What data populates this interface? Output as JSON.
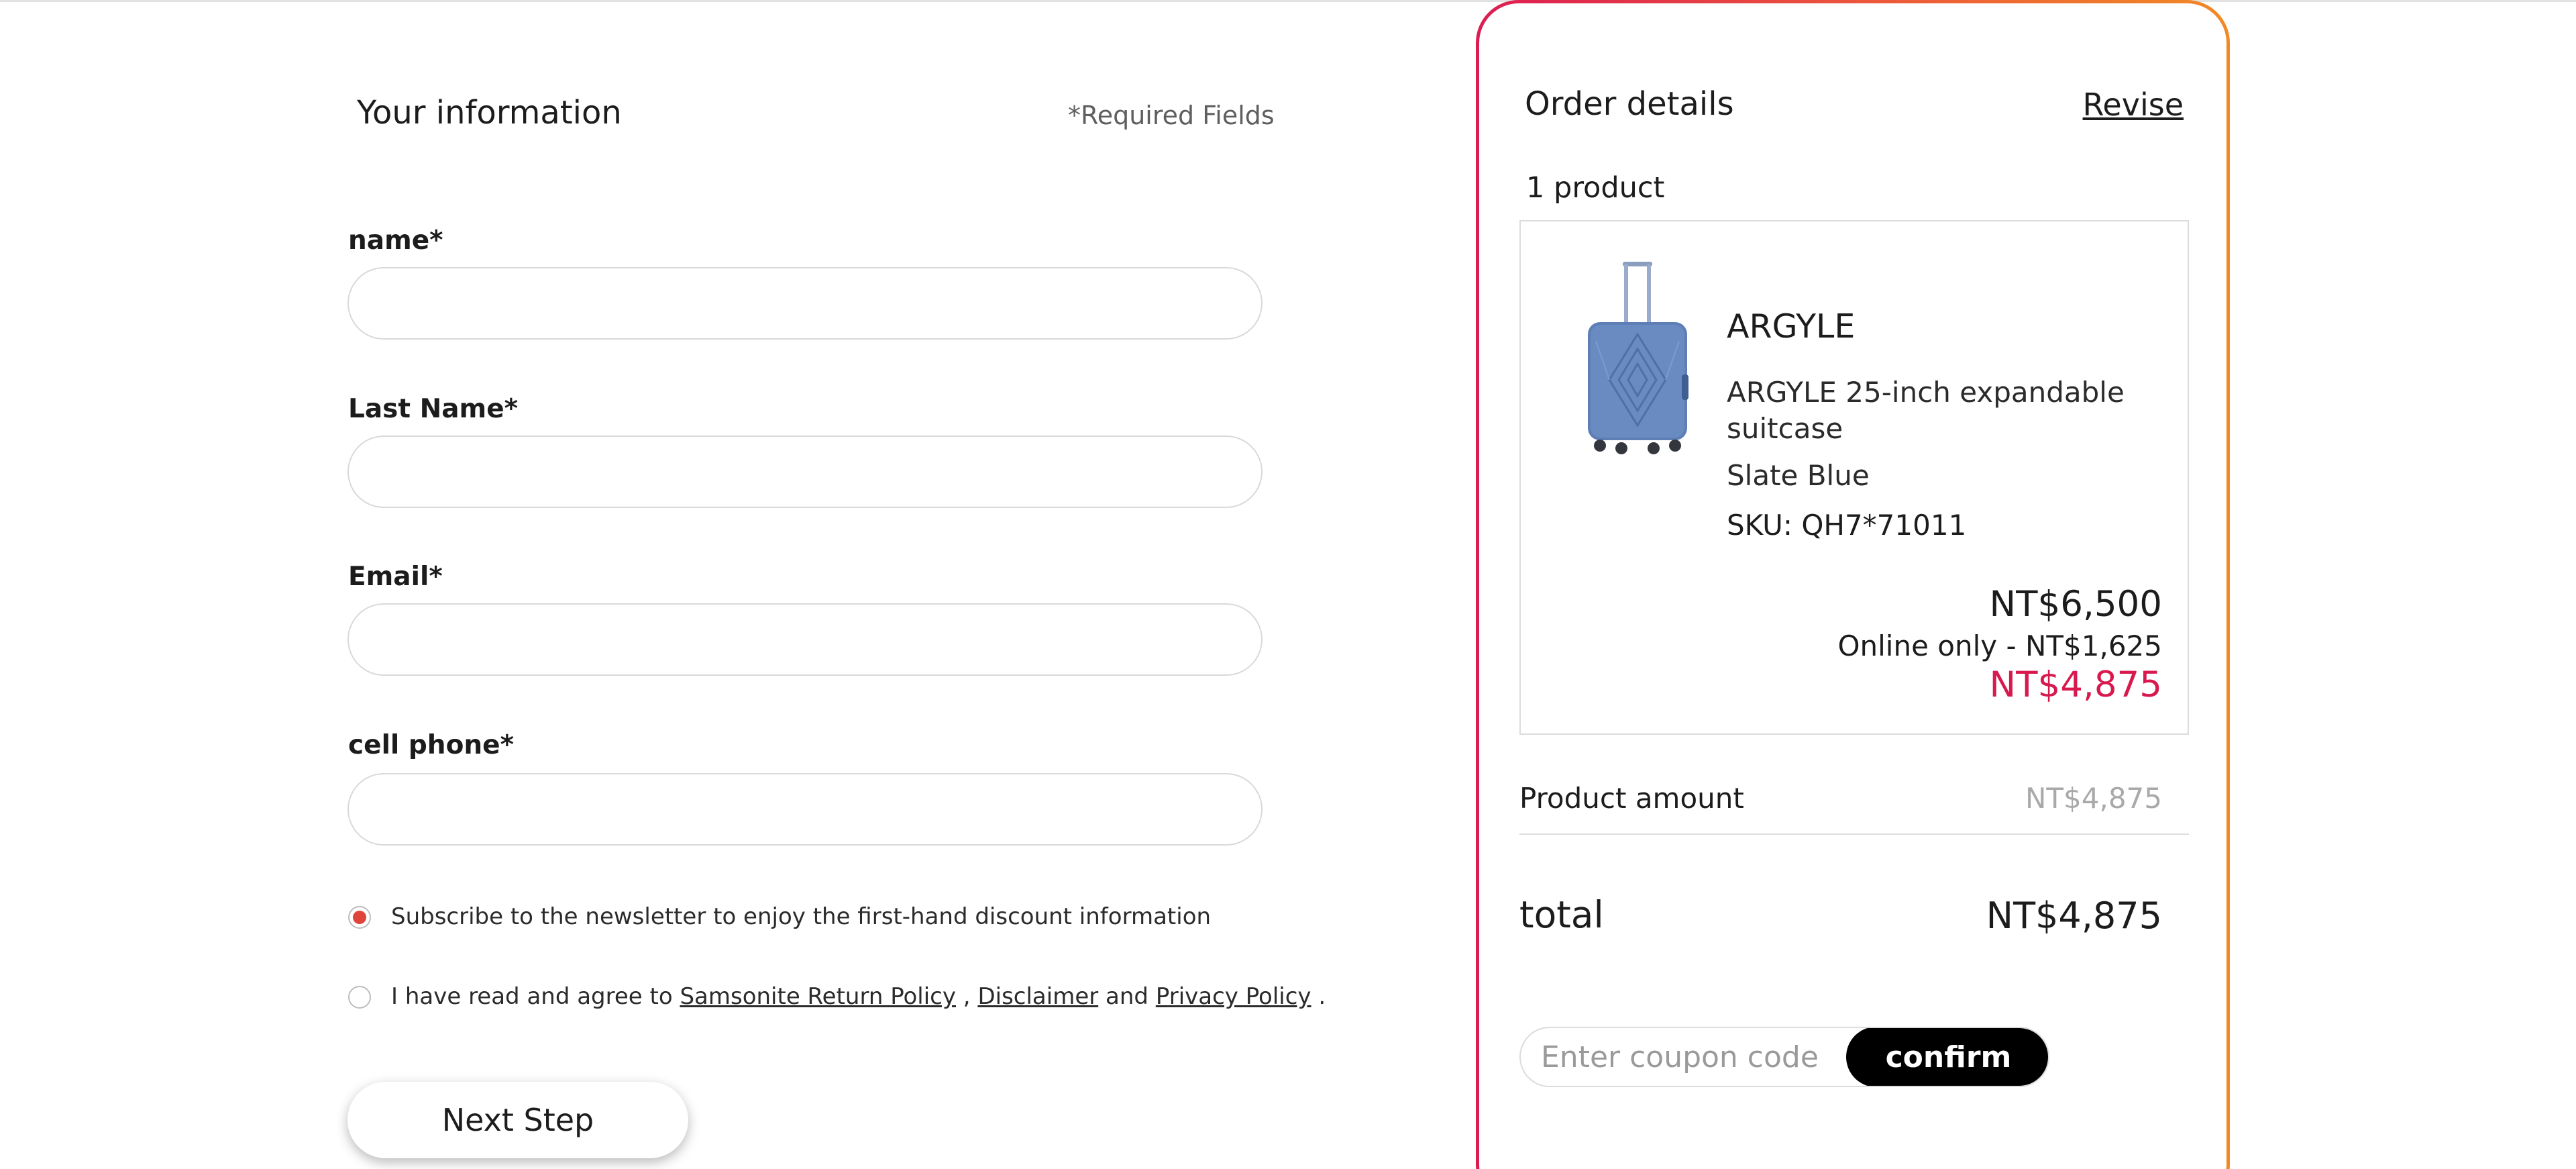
{
  "form": {
    "title": "Your information",
    "required_note": "*Required Fields",
    "fields": [
      {
        "label": "name*",
        "value": "",
        "placeholder": ""
      },
      {
        "label": "Last Name*",
        "value": "",
        "placeholder": ""
      },
      {
        "label": "Email*",
        "value": "",
        "placeholder": ""
      },
      {
        "label": "cell phone*",
        "value": "",
        "placeholder": ""
      }
    ],
    "newsletter": {
      "text": "Subscribe to the newsletter to enjoy the first-hand discount information",
      "checked": true
    },
    "agreement": {
      "prefix": "I have read and agree to ",
      "link_return_policy": "Samsonite Return Policy",
      "sep1": " , ",
      "link_disclaimer": "Disclaimer",
      "sep2": " and ",
      "link_privacy": "Privacy Policy",
      "suffix": " .",
      "checked": false
    },
    "next_button": "Next Step"
  },
  "order": {
    "title": "Order details",
    "revise_label": "Revise",
    "product_count": "1 product",
    "product": {
      "brand": "ARGYLE",
      "name": "ARGYLE 25-inch expandable suitcase",
      "color": "Slate Blue",
      "sku": "SKU: QH7*71011",
      "image_icon": "suitcase-image",
      "price_original": "NT$6,500",
      "price_promo": "Online only - NT$1,625",
      "price_final": "NT$4,875"
    },
    "product_amount_label": "Product amount",
    "product_amount_value": "NT$4,875",
    "total_label": "total",
    "total_value": "NT$4,875",
    "coupon": {
      "placeholder": "Enter coupon code",
      "value": "",
      "confirm_label": "confirm"
    }
  },
  "colors": {
    "accent_red": "#d8194e",
    "panel_gradient_start": "#dc1d52",
    "panel_gradient_end": "#f08a25",
    "radio_checked": "#e0453b"
  }
}
